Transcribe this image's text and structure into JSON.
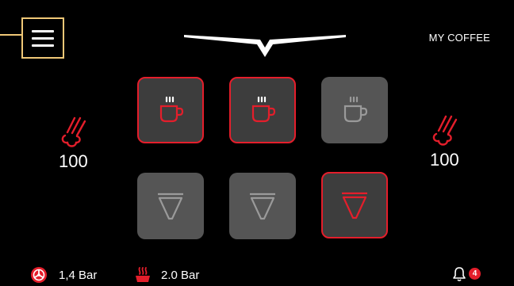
{
  "header": {
    "title": "MY COFFEE",
    "menu_icon": "hamburger-icon",
    "brand_icon": "brand-logo"
  },
  "steam_left": {
    "icon": "steam-wand-icon",
    "value": "100"
  },
  "steam_right": {
    "icon": "steam-wand-icon",
    "value": "100"
  },
  "tiles": [
    {
      "icon": "coffee-cup-icon",
      "active": true
    },
    {
      "icon": "coffee-cup-icon",
      "active": true
    },
    {
      "icon": "coffee-cup-icon",
      "active": false
    },
    {
      "icon": "filter-icon",
      "active": false
    },
    {
      "icon": "filter-icon",
      "active": false
    },
    {
      "icon": "filter-icon",
      "active": true
    }
  ],
  "status": {
    "pump_icon": "pump-icon",
    "pump_pressure": "1,4 Bar",
    "boiler_icon": "boiler-icon",
    "boiler_pressure": "2.0 Bar",
    "notifications_icon": "bell-icon",
    "notification_count": "4"
  },
  "colors": {
    "accent": "#e41e2b",
    "highlight": "#f0c877",
    "tile_inactive": "#555555",
    "tile_active": "#3d3d3d"
  }
}
